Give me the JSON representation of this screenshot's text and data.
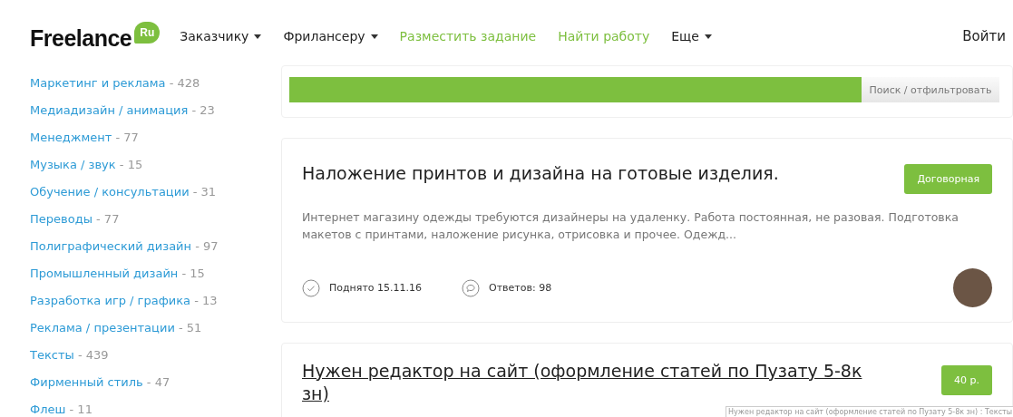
{
  "header": {
    "logo": {
      "text": "Freelance",
      "badge": "Ru"
    },
    "nav": [
      {
        "label": "Заказчику",
        "kind": "dropdown"
      },
      {
        "label": "Фрилансеру",
        "kind": "dropdown"
      },
      {
        "label": "Разместить задание",
        "kind": "accent"
      },
      {
        "label": "Найти работу",
        "kind": "accent"
      },
      {
        "label": "Еще",
        "kind": "dropdown"
      }
    ],
    "login": "Войти"
  },
  "sidebar": {
    "categories": [
      {
        "name": "Маркетинг и реклама",
        "count": "- 428"
      },
      {
        "name": "Медиадизайн / анимация",
        "count": "- 23"
      },
      {
        "name": "Менеджмент",
        "count": "- 77"
      },
      {
        "name": "Музыка / звук",
        "count": "- 15"
      },
      {
        "name": "Обучение / консультации",
        "count": "- 31"
      },
      {
        "name": "Переводы",
        "count": "- 77"
      },
      {
        "name": "Полиграфический дизайн",
        "count": "- 97"
      },
      {
        "name": "Промышленный дизайн",
        "count": "- 15"
      },
      {
        "name": "Разработка игр / графика",
        "count": "- 13"
      },
      {
        "name": "Реклама / презентации",
        "count": "- 51"
      },
      {
        "name": "Тексты",
        "count": "- 439"
      },
      {
        "name": "Фирменный стиль",
        "count": "- 47"
      },
      {
        "name": "Флеш",
        "count": "- 11"
      }
    ]
  },
  "filter": {
    "button": "Поиск / отфильтровать"
  },
  "jobs": [
    {
      "title": "Наложение принтов и дизайна на готовые изделия.",
      "hovered": false,
      "price": "Договорная",
      "description": "Интернет магазину одежды требуются дизайнеры на удаленку. Работа постоянная, не разовая. Подготовка макетов с принтами, наложение рисунка, отрисовка и прочее. Одежд...",
      "raised": "Поднято 15.11.16",
      "replies": "Ответов: 98"
    },
    {
      "title": "Нужен редактор на сайт (оформление статей по Пузату 5-8к зн)",
      "hovered": true,
      "price": "40 р.",
      "tooltip": "Нужен редактор на сайт (оформление статей по Пузату 5-8к зн) : Тексты"
    }
  ]
}
